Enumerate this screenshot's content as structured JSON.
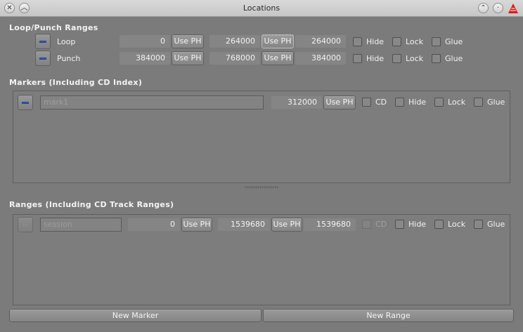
{
  "window": {
    "title": "Locations"
  },
  "loop_punch": {
    "section_title": "Loop/Punch Ranges",
    "rows": [
      {
        "label": "Loop",
        "start": "0",
        "use_ph_start": "Use PH",
        "end": "264000",
        "use_ph_end": "Use PH",
        "length": "264000",
        "hide": "Hide",
        "lock": "Lock",
        "glue": "Glue"
      },
      {
        "label": "Punch",
        "start": "384000",
        "use_ph_start": "Use PH",
        "end": "768000",
        "use_ph_end": "Use PH",
        "length": "384000",
        "hide": "Hide",
        "lock": "Lock",
        "glue": "Glue"
      }
    ]
  },
  "markers": {
    "section_title": "Markers (Including CD Index)",
    "rows": [
      {
        "name": "mark1",
        "position": "312000",
        "use_ph": "Use PH",
        "cd": "CD",
        "hide": "Hide",
        "lock": "Lock",
        "glue": "Glue"
      }
    ]
  },
  "ranges": {
    "section_title": "Ranges (Including CD Track Ranges)",
    "rows": [
      {
        "name": "session",
        "start": "0",
        "use_ph_start": "Use PH",
        "end": "1539680",
        "use_ph_end": "Use PH",
        "length": "1539680",
        "cd": "CD",
        "hide": "Hide",
        "lock": "Lock",
        "glue": "Glue"
      }
    ]
  },
  "footer": {
    "new_marker": "New Marker",
    "new_range": "New Range"
  },
  "icons": {
    "close": "close-icon",
    "collapse": "chevron-up-icon",
    "shade": "double-chevron-icon",
    "app_logo": "ardour-logo-icon",
    "remove": "minus-icon"
  },
  "colors": {
    "background": "#7b7b7b",
    "accent_bar": "#3a64c8",
    "logo_red": "#d42020"
  }
}
